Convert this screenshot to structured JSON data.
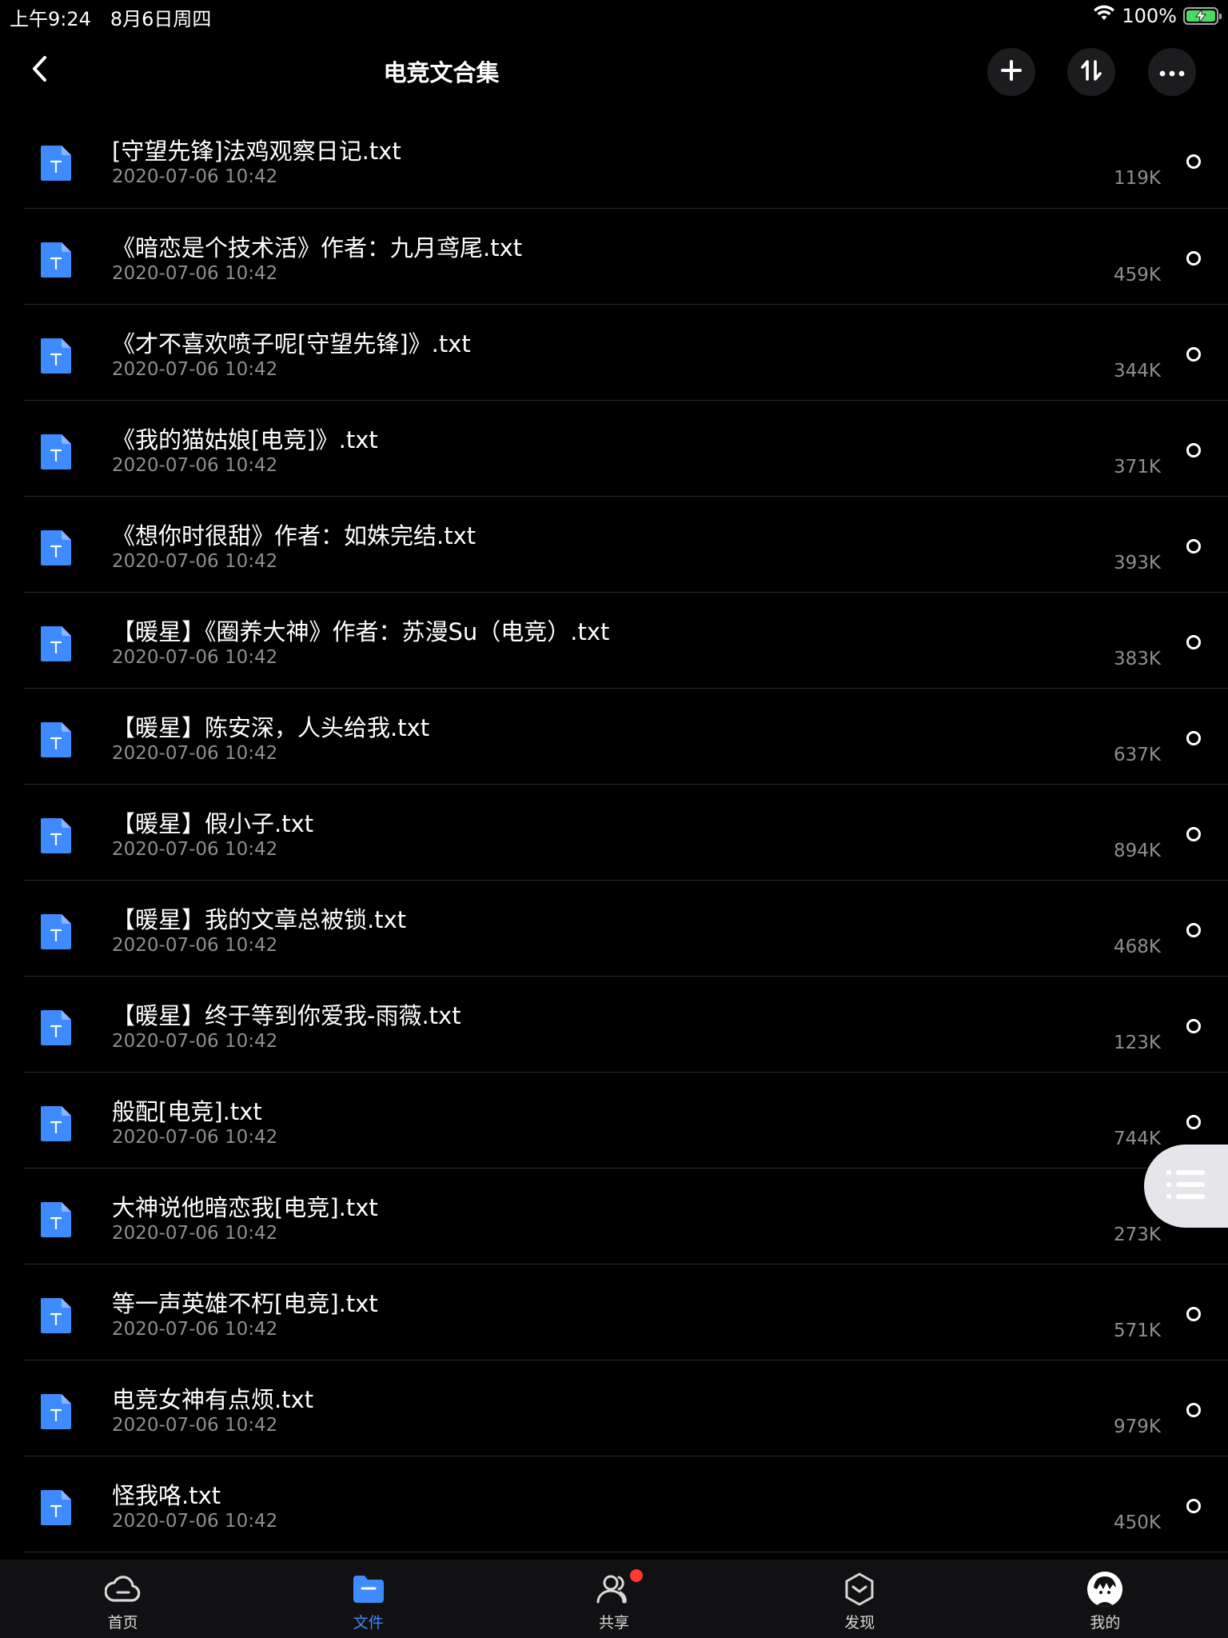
{
  "status_bar": {
    "time": "上午9:24　8月6日周四",
    "battery_percent": "100%",
    "battery_level": 1.0,
    "wifi_icon": "wifi-icon",
    "battery_icon": "battery-charging-icon"
  },
  "nav": {
    "title": "电竞文合集",
    "back_icon": "chevron-left-icon",
    "actions": [
      "plus-icon",
      "sort-icon",
      "more-icon"
    ]
  },
  "files": [
    {
      "name": "[守望先锋]法鸡观察日记.txt",
      "date": "2020-07-06 10:42",
      "size": "119K"
    },
    {
      "name": "《暗恋是个技术活》作者：九月鸢尾.txt",
      "date": "2020-07-06 10:42",
      "size": "459K"
    },
    {
      "name": "《才不喜欢喷子呢[守望先锋]》.txt",
      "date": "2020-07-06 10:42",
      "size": "344K"
    },
    {
      "name": "《我的猫姑娘[电竞]》.txt",
      "date": "2020-07-06 10:42",
      "size": "371K"
    },
    {
      "name": "《想你时很甜》作者：如姝完结.txt",
      "date": "2020-07-06 10:42",
      "size": "393K"
    },
    {
      "name": "【暖星】《圈养大神》作者：苏漫Su（电竞）.txt",
      "date": "2020-07-06 10:42",
      "size": "383K"
    },
    {
      "name": "【暖星】陈安深，人头给我.txt",
      "date": "2020-07-06 10:42",
      "size": "637K"
    },
    {
      "name": "【暖星】假小子.txt",
      "date": "2020-07-06 10:42",
      "size": "894K"
    },
    {
      "name": "【暖星】我的文章总被锁.txt",
      "date": "2020-07-06 10:42",
      "size": "468K"
    },
    {
      "name": "【暖星】终于等到你爱我-雨薇.txt",
      "date": "2020-07-06 10:42",
      "size": "123K"
    },
    {
      "name": "般配[电竞].txt",
      "date": "2020-07-06 10:42",
      "size": "744K"
    },
    {
      "name": "大神说他暗恋我[电竞].txt",
      "date": "2020-07-06 10:42",
      "size": "273K"
    },
    {
      "name": "等一声英雄不朽[电竞].txt",
      "date": "2020-07-06 10:42",
      "size": "571K"
    },
    {
      "name": "电竞女神有点烦.txt",
      "date": "2020-07-06 10:42",
      "size": "979K"
    },
    {
      "name": "怪我咯.txt",
      "date": "2020-07-06 10:42",
      "size": "450K"
    }
  ],
  "file_icon": "txt-file-icon",
  "tabs": [
    {
      "label": "首页",
      "icon": "cloud-icon",
      "active": false,
      "badge": false
    },
    {
      "label": "文件",
      "icon": "folder-icon",
      "active": true,
      "badge": false
    },
    {
      "label": "共享",
      "icon": "people-icon",
      "active": false,
      "badge": true
    },
    {
      "label": "发现",
      "icon": "discover-icon",
      "active": false,
      "badge": false
    },
    {
      "label": "我的",
      "icon": "avatar",
      "active": false,
      "badge": false
    }
  ],
  "colors": {
    "background": "#000000",
    "accent": "#3d8bff",
    "file_icon": "#3d8bff",
    "secondary_text": "#8e8e93",
    "badge": "#ff3b30",
    "battery": "#4cd964"
  }
}
